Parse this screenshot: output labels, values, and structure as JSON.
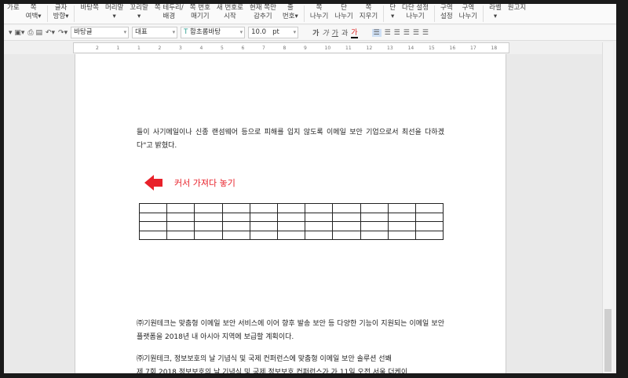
{
  "ribbon": [
    "가로",
    "쪽|여백▾",
    "글자|방향▾",
    "바탕쪽",
    "머리말|▾",
    "꼬리말|▾",
    "쪽 테두리/|배경",
    "쪽 번호|매기기",
    "새 번호로|시작",
    "현재 쪽만|감추기",
    "줄|번호▾",
    "쪽|나누기",
    "단|나누기",
    "쪽|지우기",
    "단|▾",
    "다단 설정|나누기",
    "구역|설정",
    "구역|나누기",
    "라벨|▾",
    "원고지"
  ],
  "toolbar": {
    "style": "바탕글",
    "lang": "대표",
    "font": "함초롬바탕",
    "size": "10.0",
    "unit": "pt",
    "bold": "가",
    "italic": "가",
    "underline": "가",
    "strike": "과",
    "color": "가"
  },
  "ruler": [
    "2",
    "1",
    "1",
    "2",
    "3",
    "4",
    "5",
    "6",
    "7",
    "8",
    "9",
    "10",
    "11",
    "12",
    "13",
    "14",
    "15",
    "16",
    "17",
    "18"
  ],
  "doc": {
    "p1": "들이 사기메일이나 신종 랜섬웨어 등으로 피해를 입지 않도록 이메일 보안 기업으로서 최선을 다하겠다\"고 밝혔다.",
    "annotation": "커서 가져다 놓기",
    "p2": "㈜기원테크는 맞춤형 이메일 보안 서비스에 이어 향후 발송 보안 등 다양한 기능이 지원되는 이메일 보안 플랫폼을 2018년 내 아시아 지역에 보급할 계획이다.",
    "p3": "㈜기원테크, 정보보호의 날 기념식 및 국제 컨퍼런스에 맞춤형 이메일 보안 솔루션 선봬",
    "p4": "제 7회 2018 정보보호의 날 기념식 및 국제 정보보호 컨퍼런스가 가 11일 오전 서울 더케이"
  },
  "table": {
    "rows": 4,
    "cols": 11
  },
  "colors": {
    "accent": "#e8212a"
  }
}
